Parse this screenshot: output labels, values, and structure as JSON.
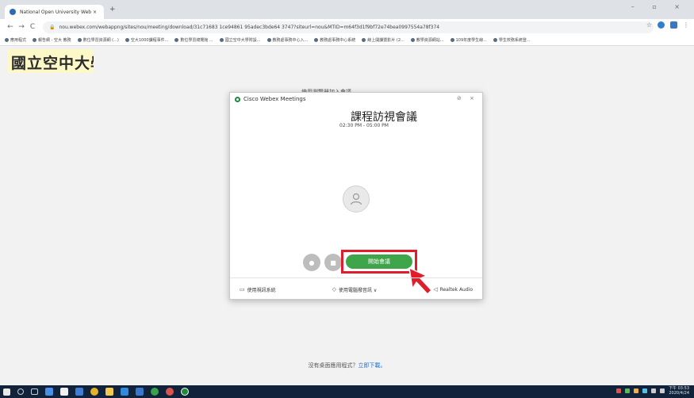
{
  "browser": {
    "tab_title": "National Open University Web ×",
    "tab_close": "×",
    "new_tab": "+",
    "url": "nou.webex.com/webappng/sites/nou/meeting/download/31c71683 1ce94861 95adec3bde64 3747?siteurl=nou&MTID=m64f3d1f9bf72e74bea0997554a78f374",
    "back": "←",
    "forward": "→",
    "reload": "C",
    "window_controls": "– ▫ ×"
  },
  "bookmarks": [
    "應用程式",
    "報告網 - 空大 教務",
    "數位學習資源網 (...)",
    "空大1000課程事件...",
    "數位學習總覽館 ...",
    "國立空中大學附設...",
    "教務處事務中心入...",
    "教務處事務中心系統",
    "線上開課暨影片 (2...",
    "教學資源網站...",
    "109年度學生線...",
    "學生校務系統登..."
  ],
  "page": {
    "logo_text": "國立空中大學",
    "behind_text": "使用瀏覽器加入會議",
    "no_desktop_text": "沒有桌面應用程式？",
    "download_link": "立即下載。"
  },
  "dialog": {
    "app_name": "Cisco Webex Meetings",
    "title_controls": "⊘ ×",
    "meeting_title": "課程訪視會議",
    "meeting_time": "02:30 PM - 05:00 PM",
    "start_button": "開始會議",
    "footer": {
      "share": "使用視訊系統",
      "audio": "使用電腦撥音訊 ∨",
      "device": "Realtek Audio"
    }
  },
  "taskbar": {
    "clock_time": "下午 03:53",
    "clock_date": "2020/4/24"
  },
  "colors": {
    "start_green": "#3fa54a",
    "highlight_red": "#e21d2b",
    "taskbar": "#10233b"
  }
}
